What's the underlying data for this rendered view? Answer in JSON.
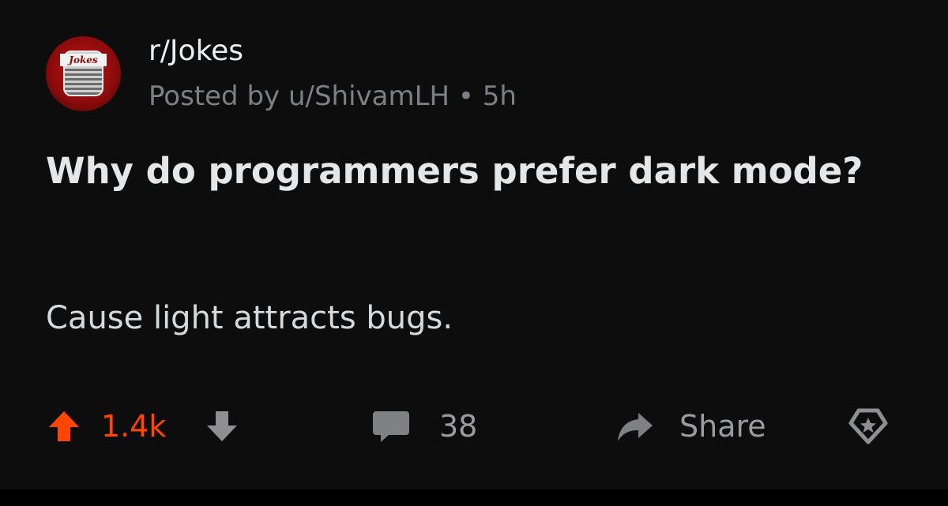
{
  "post": {
    "subreddit": "r/Jokes",
    "meta": "Posted by u/ShivamLH • 5h",
    "avatar_text": "Jokes",
    "title": "Why do programmers prefer dark mode?",
    "body": "Cause light attracts bugs."
  },
  "actions": {
    "score": "1.4k",
    "comments": "38",
    "share": "Share",
    "upvote_icon": "upvote-arrow",
    "downvote_icon": "downvote-arrow",
    "comment_icon": "speech-bubble",
    "share_icon": "share-arrow",
    "award_icon": "award-star"
  },
  "colors": {
    "background": "#0d0d0d",
    "upvote_active": "#ff4500",
    "muted": "#9a9ca0",
    "text": "#d7dadc"
  }
}
